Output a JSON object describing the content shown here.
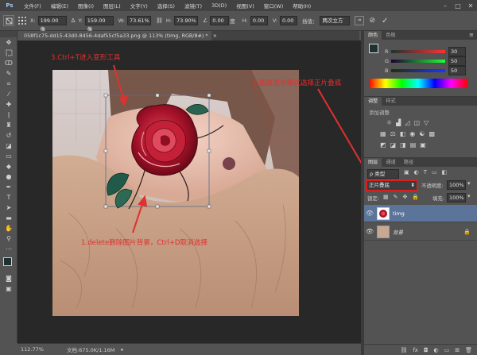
{
  "menu": {
    "logo": "Ps",
    "items": [
      "文件(F)",
      "编辑(E)",
      "图像(I)",
      "图层(L)",
      "文字(Y)",
      "选择(S)",
      "滤镜(T)",
      "3D(D)",
      "视图(V)",
      "窗口(W)",
      "帮助(H)"
    ],
    "window_controls": [
      "–",
      "□",
      "✕"
    ]
  },
  "options": {
    "x_label": "X:",
    "x_value": "199.00 像",
    "y_label": "Y:",
    "y_value": "159.00 像",
    "w_label": "W:",
    "w_value": "73.61%",
    "h_label": "H:",
    "h_value": "73.90%",
    "angle_value": "0.00",
    "h2_label": "H:",
    "h2_value": "0.00",
    "v_label": "V:",
    "v_value": "0.00",
    "interp_label": "插值：",
    "interp_value": "两次立方"
  },
  "document": {
    "tab_title": "058f1c75-dd15-43d0-8456-4daf55cf5a33.png @ 113% (timg, RGB/8#) *",
    "tab_close": "×"
  },
  "status": {
    "zoom": "112.77%",
    "doc_info": "文档:675.0K/1.16M"
  },
  "color_panel": {
    "tabs": [
      "颜色",
      "色板"
    ],
    "channels": [
      {
        "label": "R",
        "value": "30"
      },
      {
        "label": "G",
        "value": "50"
      },
      {
        "label": "B",
        "value": "50"
      }
    ]
  },
  "adjust_panel": {
    "tabs": [
      "调整",
      "样式"
    ],
    "title": "添加调整"
  },
  "layers_panel": {
    "tabs": [
      "图层",
      "通道",
      "路径"
    ],
    "filter_label": "ρ 类型",
    "blend_mode": "正片叠底",
    "opacity_label": "不透明度:",
    "opacity_value": "100%",
    "lock_label": "锁定:",
    "fill_label": "填充:",
    "fill_value": "100%",
    "layers": [
      {
        "name": "timg",
        "selected": true
      },
      {
        "name": "背景",
        "selected": false
      }
    ]
  },
  "annotations": {
    "step3": "3.Ctrl+T进入变形工具",
    "step2": "2.图层混合模式选择正片叠底",
    "step1": "1.delete删除图片背景，Ctrl+D取消选择"
  },
  "colors": {
    "annotation_red": "#e03030",
    "selected_layer": "#5b7499",
    "ui_dark": "#535353"
  }
}
